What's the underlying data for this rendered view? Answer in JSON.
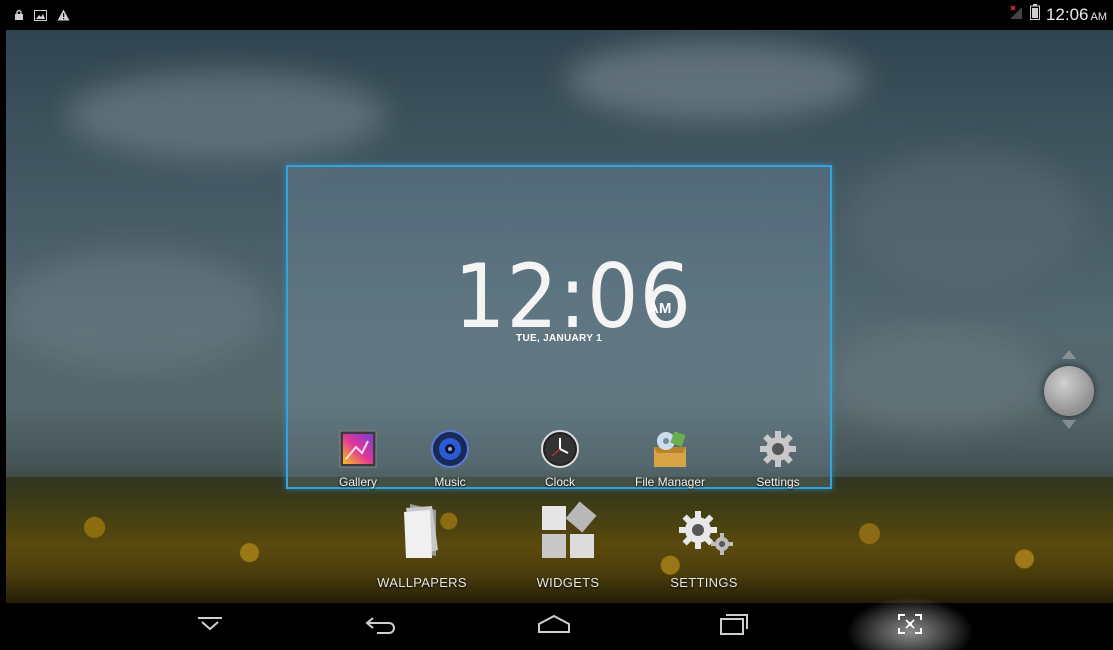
{
  "status_bar": {
    "icons_left": [
      "lock-icon",
      "image-notification-icon",
      "warning-icon"
    ],
    "icons_right": [
      "no-signal-icon",
      "battery-icon"
    ],
    "time": "12:06",
    "ampm": "AM"
  },
  "widget": {
    "time": "12:06",
    "ampm": "AM",
    "date": "TUE, JANUARY 1"
  },
  "apps": [
    {
      "label": "Gallery",
      "icon": "gallery-icon"
    },
    {
      "label": "Music",
      "icon": "music-icon"
    },
    {
      "label": "Clock",
      "icon": "clock-icon"
    },
    {
      "label": "File Manager",
      "icon": "file-manager-icon"
    },
    {
      "label": "Settings",
      "icon": "settings-icon"
    }
  ],
  "overview_options": [
    {
      "label": "WALLPAPERS",
      "icon": "wallpapers-icon"
    },
    {
      "label": "WIDGETS",
      "icon": "widgets-icon"
    },
    {
      "label": "SETTINGS",
      "icon": "settings-gears-icon"
    }
  ],
  "nav_bar": [
    "hide-keyboard-icon",
    "back-icon",
    "home-icon",
    "recents-icon",
    "screenshot-icon"
  ],
  "colors": {
    "frame_border": "#33a3e0",
    "status_bg": "#000000"
  }
}
